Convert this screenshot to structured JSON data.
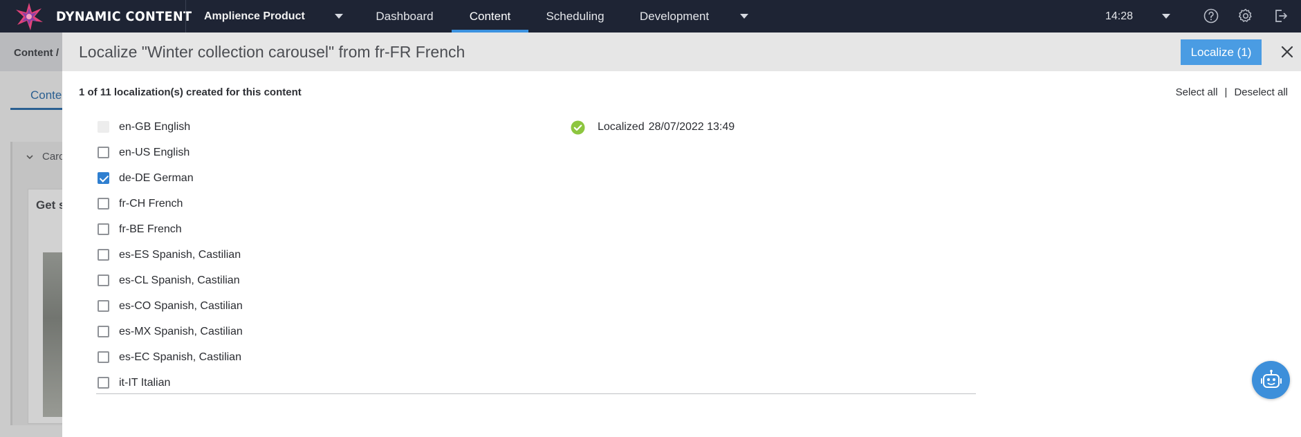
{
  "brand": {
    "name": "DYNAMIC CONTENT",
    "accent": "#e2437a"
  },
  "topbar": {
    "hub": "Amplience Product",
    "tabs": [
      {
        "label": "Dashboard",
        "active": false
      },
      {
        "label": "Content",
        "active": true
      },
      {
        "label": "Scheduling",
        "active": false
      },
      {
        "label": "Development",
        "active": false
      }
    ],
    "time": "14:28",
    "icons": [
      "help-icon",
      "gear-icon",
      "logout-icon"
    ]
  },
  "background": {
    "breadcrumb": "Content /",
    "tab": "Conte",
    "card_label": "Caro",
    "card_title": "Get s"
  },
  "modal": {
    "title": "Localize \"Winter collection carousel\" from fr-FR French",
    "localize_button": "Localize (1)",
    "summary": "1 of 11 localization(s) created for this content",
    "select_all": "Select all",
    "separator": "|",
    "deselect_all": "Deselect all",
    "locales": [
      {
        "label": "en-GB English",
        "checked": false,
        "disabled": true,
        "status": "Localized",
        "date": "28/07/2022 13:49"
      },
      {
        "label": "en-US English",
        "checked": false,
        "disabled": false
      },
      {
        "label": "de-DE German",
        "checked": true,
        "disabled": false
      },
      {
        "label": "fr-CH French",
        "checked": false,
        "disabled": false
      },
      {
        "label": "fr-BE French",
        "checked": false,
        "disabled": false
      },
      {
        "label": "es-ES Spanish, Castilian",
        "checked": false,
        "disabled": false
      },
      {
        "label": "es-CL Spanish, Castilian",
        "checked": false,
        "disabled": false
      },
      {
        "label": "es-CO Spanish, Castilian",
        "checked": false,
        "disabled": false
      },
      {
        "label": "es-MX Spanish, Castilian",
        "checked": false,
        "disabled": false
      },
      {
        "label": "es-EC Spanish, Castilian",
        "checked": false,
        "disabled": false
      },
      {
        "label": "it-IT Italian",
        "checked": false,
        "disabled": false
      }
    ]
  },
  "colors": {
    "nav_bg": "#1e2434",
    "primary": "#4a9ce3",
    "checked": "#2f7fd0",
    "success": "#8dc63f"
  }
}
